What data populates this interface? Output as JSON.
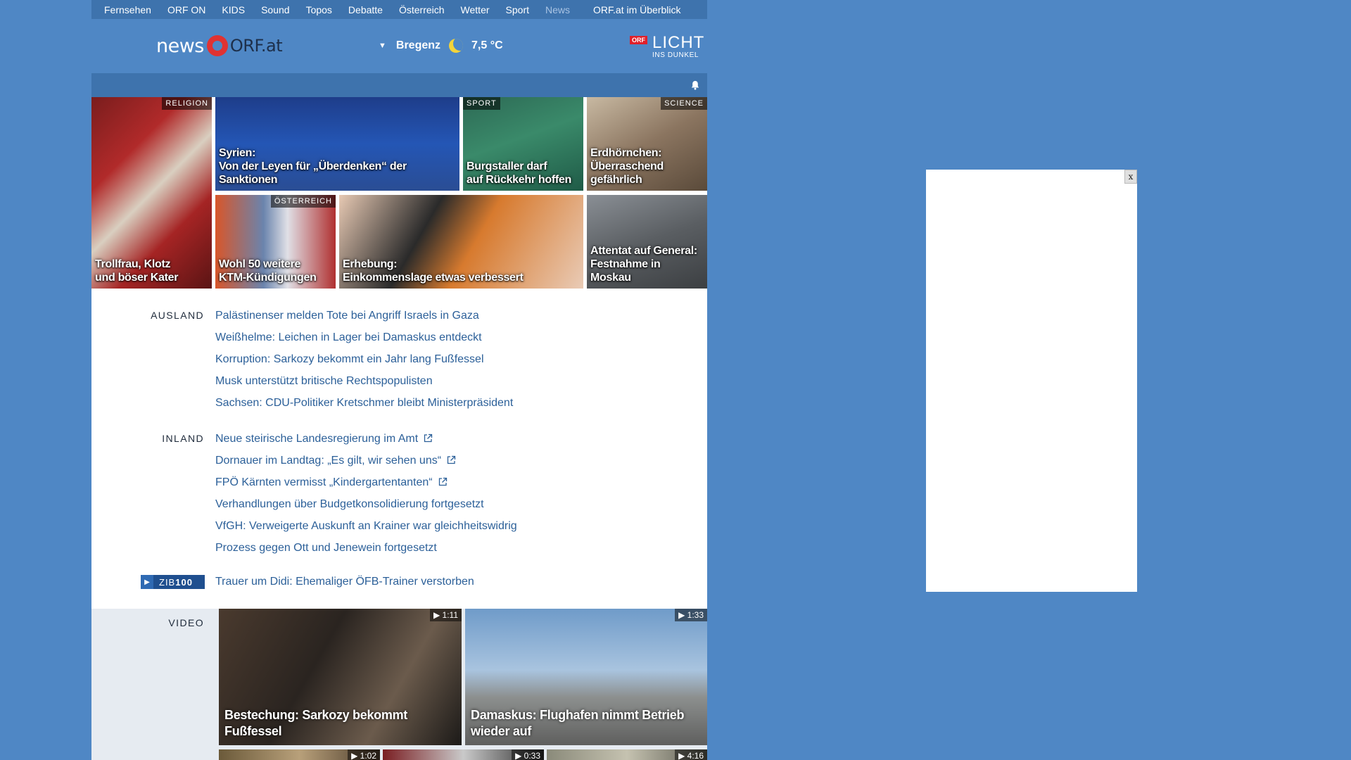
{
  "topnav": {
    "items": [
      "Fernsehen",
      "ORF ON",
      "KIDS",
      "Sound",
      "Topos",
      "Debatte",
      "Österreich",
      "Wetter",
      "Sport",
      "News"
    ],
    "active": "News",
    "overview": "ORF.at im Überblick"
  },
  "header": {
    "logo_news": "news",
    "logo_orf": "ORF.at",
    "weather": {
      "location": "Bregenz",
      "temperature": "7,5 °C",
      "icon": "moon-icon"
    },
    "campaign": {
      "badge": "ORF",
      "title": "LICHT",
      "subtitle": "INS DUNKEL"
    }
  },
  "tiles": [
    {
      "tag": "RELIGION",
      "caption_1": "Trollfrau, Klotz",
      "caption_2": "und böser Kater"
    },
    {
      "tag": "",
      "caption_1": "Syrien:",
      "caption_2": "Von der Leyen für „Überdenken“ der Sanktionen"
    },
    {
      "tag": "SPORT",
      "caption_1": "Burgstaller darf",
      "caption_2": "auf Rückkehr hoffen"
    },
    {
      "tag": "SCIENCE",
      "caption_1": "Erdhörnchen:",
      "caption_2": "Überraschend",
      "caption_3": "gefährlich"
    },
    {
      "tag": "ÖSTERREICH",
      "caption_1": "Wohl 50 weitere",
      "caption_2": "KTM-Kündigungen"
    },
    {
      "tag": "",
      "caption_1": "Erhebung:",
      "caption_2": "Einkommenslage etwas verbessert"
    },
    {
      "tag": "",
      "caption_1": "Attentat auf General:",
      "caption_2": "Festnahme in Moskau"
    }
  ],
  "ausland": {
    "label": "AUSLAND",
    "items": [
      "Palästinenser melden Tote bei Angriff Israels in Gaza",
      "Weißhelme: Leichen in Lager bei Damaskus entdeckt",
      "Korruption: Sarkozy bekommt ein Jahr lang Fußfessel",
      "Musk unterstützt britische Rechtspopulisten",
      "Sachsen: CDU-Politiker Kretschmer bleibt Ministerpräsident"
    ]
  },
  "inland": {
    "label": "INLAND",
    "items": [
      "Neue steirische Landesregierung im Amt",
      "Dornauer im Landtag: „Es gilt, wir sehen uns“",
      "FPÖ Kärnten vermisst „Kindergartentanten“",
      "Verhandlungen über Budgetkonsolidierung fortgesetzt",
      "VfGH: Verweigerte Auskunft an Krainer war gleichheitswidrig",
      "Prozess gegen Ott und Jenewein fortgesetzt"
    ]
  },
  "zib": {
    "label_a": "ZIB",
    "label_b": "100",
    "headline": "Trauer um Didi: Ehemaliger ÖFB-Trainer verstorben"
  },
  "video": {
    "label": "VIDEO",
    "items": [
      {
        "duration": "1:11",
        "caption": "Bestechung: Sarkozy bekommt Fußfessel"
      },
      {
        "duration": "1:33",
        "caption_1": "Damaskus: Flughafen nimmt Betrieb",
        "caption_2": "wieder auf"
      },
      {
        "duration": "1:02"
      },
      {
        "duration": "0:33"
      },
      {
        "duration": "4:16"
      }
    ]
  },
  "ad": {
    "close": "x"
  }
}
